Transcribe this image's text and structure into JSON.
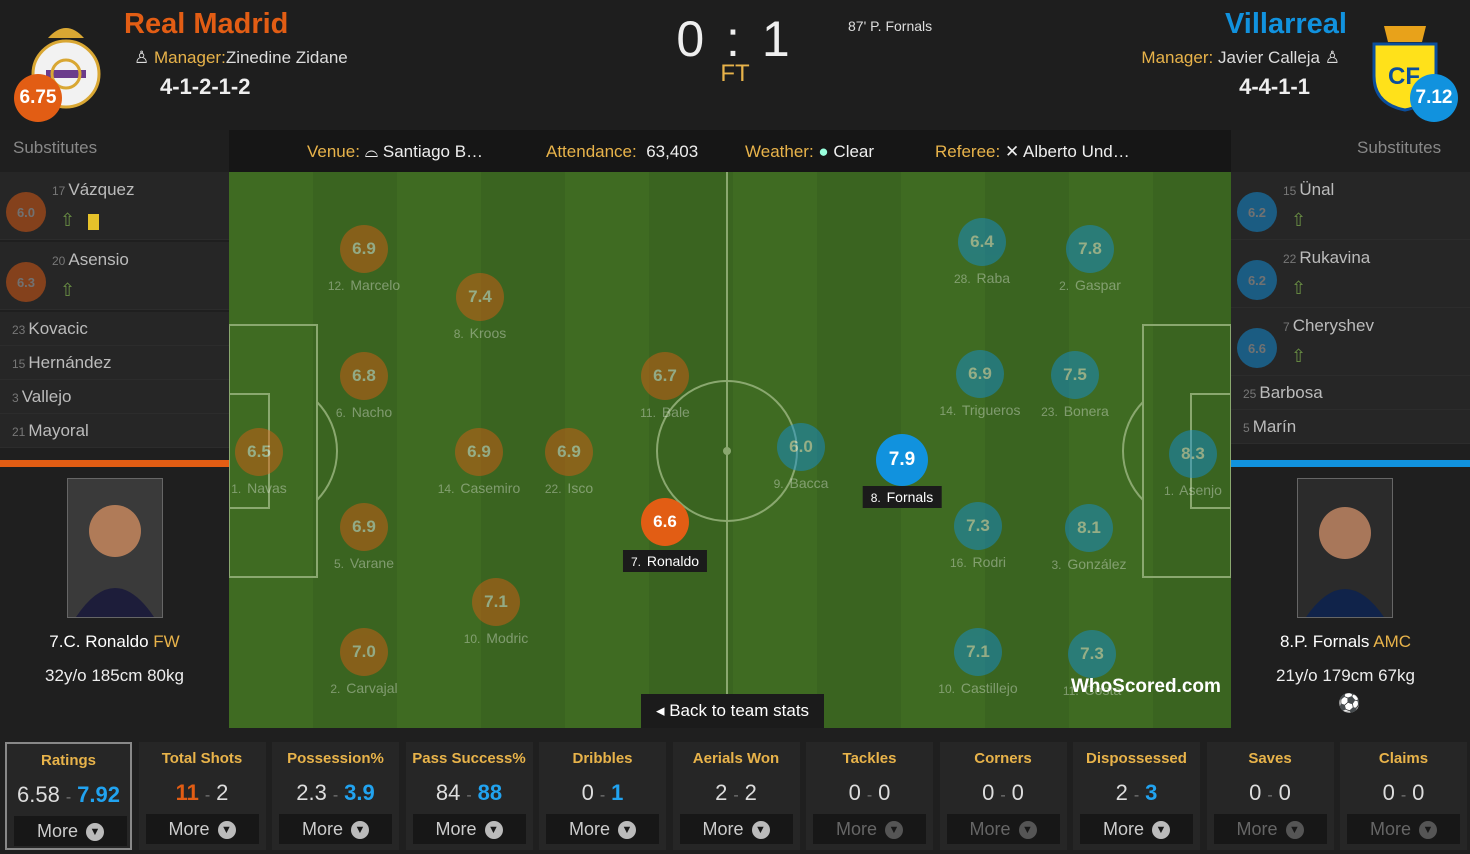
{
  "home": {
    "name": "Real Madrid",
    "manager_label": "Manager:",
    "manager": "Zinedine Zidane",
    "formation": "4-1-2-1-2",
    "rating": "6.75",
    "color": "#e25d14"
  },
  "away": {
    "name": "Villarreal",
    "manager_label": "Manager:",
    "manager": "Javier Calleja",
    "formation": "4-4-1-1",
    "rating": "7.12",
    "color": "#1192de"
  },
  "score": "0 : 1",
  "status": "FT",
  "goal_event": "87' P. Fornals",
  "info": {
    "venue_label": "Venue:",
    "venue": "Santiago B…",
    "attendance_label": "Attendance:",
    "attendance": "63,403",
    "weather_label": "Weather:",
    "weather": "Clear",
    "referee_label": "Referee:",
    "referee": "Alberto Und…"
  },
  "subs_label": "Substitutes",
  "home_subs": [
    {
      "num": "17",
      "name": "Vázquez",
      "rating": "6.0"
    },
    {
      "num": "20",
      "name": "Asensio",
      "rating": "6.3"
    },
    {
      "num": "23",
      "name": "Kovacic"
    },
    {
      "num": "15",
      "name": "Hernández"
    },
    {
      "num": "3",
      "name": "Vallejo"
    },
    {
      "num": "21",
      "name": "Mayoral"
    }
  ],
  "away_subs": [
    {
      "num": "15",
      "name": "Ünal",
      "rating": "6.2"
    },
    {
      "num": "22",
      "name": "Rukavina",
      "rating": "6.2"
    },
    {
      "num": "7",
      "name": "Cheryshev",
      "rating": "6.6"
    },
    {
      "num": "25",
      "name": "Barbosa"
    },
    {
      "num": "5",
      "name": "Marín"
    }
  ],
  "home_players": [
    {
      "num": "1",
      "name": "Navas",
      "rating": "6.5"
    },
    {
      "num": "12",
      "name": "Marcelo",
      "rating": "6.9"
    },
    {
      "num": "6",
      "name": "Nacho",
      "rating": "6.8"
    },
    {
      "num": "5",
      "name": "Varane",
      "rating": "6.9"
    },
    {
      "num": "2",
      "name": "Carvajal",
      "rating": "7.0"
    },
    {
      "num": "8",
      "name": "Kroos",
      "rating": "7.4"
    },
    {
      "num": "14",
      "name": "Casemiro",
      "rating": "6.9"
    },
    {
      "num": "10",
      "name": "Modric",
      "rating": "7.1"
    },
    {
      "num": "22",
      "name": "Isco",
      "rating": "6.9"
    },
    {
      "num": "11",
      "name": "Bale",
      "rating": "6.7"
    },
    {
      "num": "7",
      "name": "Ronaldo",
      "rating": "6.6"
    }
  ],
  "away_players": [
    {
      "num": "1",
      "name": "Asenjo",
      "rating": "8.3"
    },
    {
      "num": "2",
      "name": "Gaspar",
      "rating": "7.8"
    },
    {
      "num": "23",
      "name": "Bonera",
      "rating": "7.5"
    },
    {
      "num": "3",
      "name": "González",
      "rating": "8.1"
    },
    {
      "num": "11",
      "name": "Costa",
      "rating": "7.3"
    },
    {
      "num": "28",
      "name": "Raba",
      "rating": "6.4"
    },
    {
      "num": "14",
      "name": "Trigueros",
      "rating": "6.9"
    },
    {
      "num": "16",
      "name": "Rodri",
      "rating": "7.3"
    },
    {
      "num": "10",
      "name": "Castillejo",
      "rating": "7.1"
    },
    {
      "num": "8",
      "name": "Fornals",
      "rating": "7.9"
    },
    {
      "num": "9",
      "name": "Bacca",
      "rating": "6.0"
    }
  ],
  "back_button": "Back to team stats",
  "brand": "WhoScored.com",
  "home_featured": {
    "name": "7.C. Ronaldo",
    "pos": "FW",
    "info": "32y/o 185cm 80kg"
  },
  "away_featured": {
    "name": "8.P. Fornals",
    "pos": "AMC",
    "info": "21y/o 179cm 67kg"
  },
  "stats": [
    {
      "title": "Ratings",
      "home": "6.58",
      "away": "7.92",
      "more": "More"
    },
    {
      "title": "Total Shots",
      "home": "11",
      "away": "2",
      "more": "More"
    },
    {
      "title": "Possession%",
      "home": "2.3",
      "away": "3.9",
      "more": "More"
    },
    {
      "title": "Pass Success%",
      "home": "84",
      "away": "88",
      "more": "More"
    },
    {
      "title": "Dribbles",
      "home": "0",
      "away": "1",
      "more": "More"
    },
    {
      "title": "Aerials Won",
      "home": "2",
      "away": "2",
      "more": "More"
    },
    {
      "title": "Tackles",
      "home": "0",
      "away": "0",
      "more": "More"
    },
    {
      "title": "Corners",
      "home": "0",
      "away": "0",
      "more": "More"
    },
    {
      "title": "Dispossessed",
      "home": "2",
      "away": "3",
      "more": "More"
    },
    {
      "title": "Saves",
      "home": "0",
      "away": "0",
      "more": "More"
    },
    {
      "title": "Claims",
      "home": "0",
      "away": "0",
      "more": "More"
    }
  ]
}
